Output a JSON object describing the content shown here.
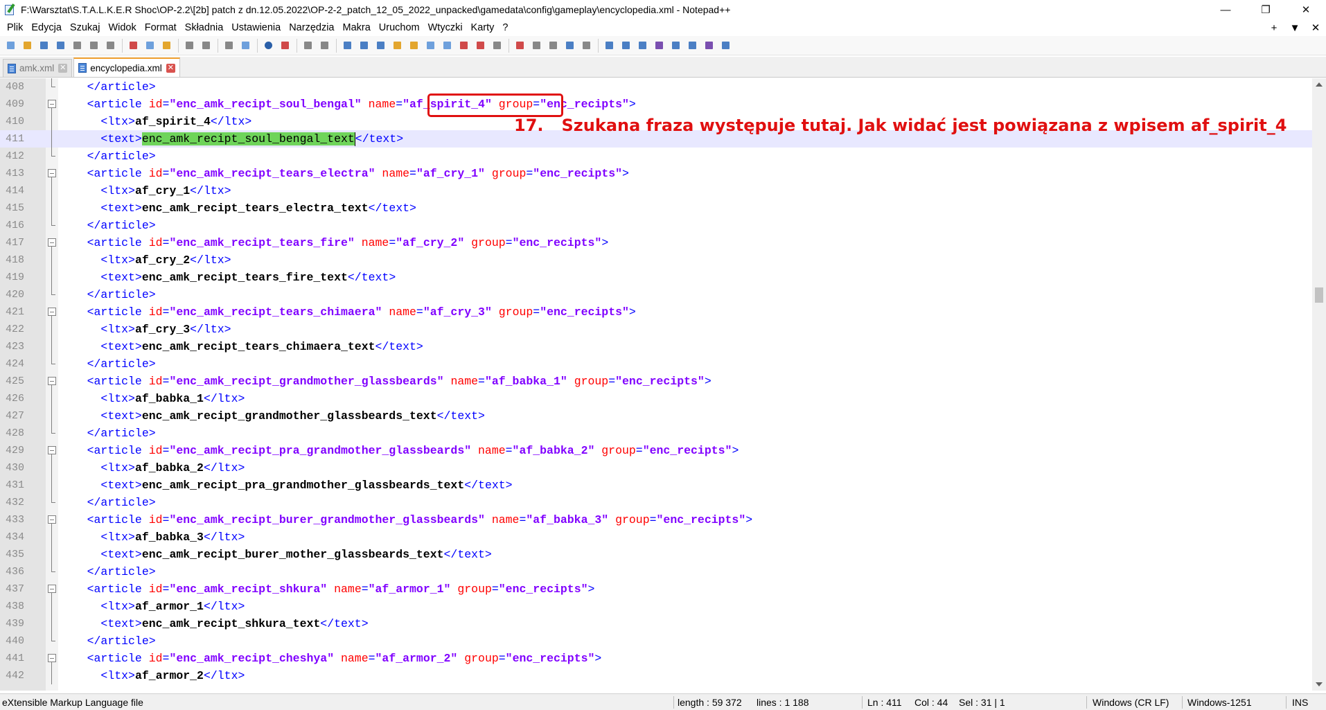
{
  "window": {
    "title": "F:\\Warsztat\\S.T.A.L.K.E.R Shoc\\OP-2.2\\[2b] patch z dn.12.05.2022\\OP-2-2_patch_12_05_2022_unpacked\\gamedata\\config\\gameplay\\encyclopedia.xml - Notepad++",
    "minimize": "—",
    "maximize": "❐",
    "close": "✕"
  },
  "menu": {
    "items": [
      "Plik",
      "Edycja",
      "Szukaj",
      "Widok",
      "Format",
      "Składnia",
      "Ustawienia",
      "Narzędzia",
      "Makra",
      "Uruchom",
      "Wtyczki",
      "Karty",
      "?"
    ],
    "right": [
      "+",
      "▼",
      "✕"
    ]
  },
  "tabs": [
    {
      "label": "amk.xml",
      "active": false
    },
    {
      "label": "encyclopedia.xml",
      "active": true
    }
  ],
  "editor": {
    "lines": [
      {
        "n": "408",
        "fold": "mid",
        "indent": 2,
        "parts": [
          [
            "tag",
            "</article>"
          ]
        ]
      },
      {
        "n": "409",
        "fold": "box",
        "indent": 2,
        "parts": [
          [
            "tag",
            "<article "
          ],
          [
            "attr",
            "id"
          ],
          [
            "tag",
            "="
          ],
          [
            "val",
            "\"enc_amk_recipt_soul_bengal\""
          ],
          [
            "tag",
            " "
          ],
          [
            "attr",
            "name"
          ],
          [
            "tag",
            "="
          ],
          [
            "val",
            "\"af_spirit_4\""
          ],
          [
            "tag",
            " "
          ],
          [
            "attr",
            "group"
          ],
          [
            "tag",
            "="
          ],
          [
            "val",
            "\"enc_recipts\""
          ],
          [
            "tag",
            ">"
          ]
        ]
      },
      {
        "n": "410",
        "fold": "mid",
        "indent": 3,
        "parts": [
          [
            "tag",
            "<ltx>"
          ],
          [
            "txt",
            "af_spirit_4"
          ],
          [
            "tag",
            "</ltx>"
          ]
        ]
      },
      {
        "n": "411",
        "fold": "mid",
        "indent": 3,
        "current": true,
        "parts": [
          [
            "tag",
            "<text>"
          ],
          [
            "sel",
            "enc_amk_recipt_soul_bengal_text"
          ],
          [
            "caret",
            ""
          ],
          [
            "tag",
            "</text>"
          ]
        ]
      },
      {
        "n": "412",
        "fold": "mid",
        "indent": 2,
        "parts": [
          [
            "tag",
            "</article>"
          ]
        ]
      },
      {
        "n": "413",
        "fold": "box",
        "indent": 2,
        "parts": [
          [
            "tag",
            "<article "
          ],
          [
            "attr",
            "id"
          ],
          [
            "tag",
            "="
          ],
          [
            "val",
            "\"enc_amk_recipt_tears_electra\""
          ],
          [
            "tag",
            " "
          ],
          [
            "attr",
            "name"
          ],
          [
            "tag",
            "="
          ],
          [
            "val",
            "\"af_cry_1\""
          ],
          [
            "tag",
            " "
          ],
          [
            "attr",
            "group"
          ],
          [
            "tag",
            "="
          ],
          [
            "val",
            "\"enc_recipts\""
          ],
          [
            "tag",
            ">"
          ]
        ]
      },
      {
        "n": "414",
        "fold": "mid",
        "indent": 3,
        "parts": [
          [
            "tag",
            "<ltx>"
          ],
          [
            "txt",
            "af_cry_1"
          ],
          [
            "tag",
            "</ltx>"
          ]
        ]
      },
      {
        "n": "415",
        "fold": "mid",
        "indent": 3,
        "parts": [
          [
            "tag",
            "<text>"
          ],
          [
            "txt",
            "enc_amk_recipt_tears_electra_text"
          ],
          [
            "tag",
            "</text>"
          ]
        ]
      },
      {
        "n": "416",
        "fold": "mid",
        "indent": 2,
        "parts": [
          [
            "tag",
            "</article>"
          ]
        ]
      },
      {
        "n": "417",
        "fold": "box",
        "indent": 2,
        "parts": [
          [
            "tag",
            "<article "
          ],
          [
            "attr",
            "id"
          ],
          [
            "tag",
            "="
          ],
          [
            "val",
            "\"enc_amk_recipt_tears_fire\""
          ],
          [
            "tag",
            " "
          ],
          [
            "attr",
            "name"
          ],
          [
            "tag",
            "="
          ],
          [
            "val",
            "\"af_cry_2\""
          ],
          [
            "tag",
            " "
          ],
          [
            "attr",
            "group"
          ],
          [
            "tag",
            "="
          ],
          [
            "val",
            "\"enc_recipts\""
          ],
          [
            "tag",
            ">"
          ]
        ]
      },
      {
        "n": "418",
        "fold": "mid",
        "indent": 3,
        "parts": [
          [
            "tag",
            "<ltx>"
          ],
          [
            "txt",
            "af_cry_2"
          ],
          [
            "tag",
            "</ltx>"
          ]
        ]
      },
      {
        "n": "419",
        "fold": "mid",
        "indent": 3,
        "parts": [
          [
            "tag",
            "<text>"
          ],
          [
            "txt",
            "enc_amk_recipt_tears_fire_text"
          ],
          [
            "tag",
            "</text>"
          ]
        ]
      },
      {
        "n": "420",
        "fold": "mid",
        "indent": 2,
        "parts": [
          [
            "tag",
            "</article>"
          ]
        ]
      },
      {
        "n": "421",
        "fold": "box",
        "indent": 2,
        "parts": [
          [
            "tag",
            "<article "
          ],
          [
            "attr",
            "id"
          ],
          [
            "tag",
            "="
          ],
          [
            "val",
            "\"enc_amk_recipt_tears_chimaera\""
          ],
          [
            "tag",
            " "
          ],
          [
            "attr",
            "name"
          ],
          [
            "tag",
            "="
          ],
          [
            "val",
            "\"af_cry_3\""
          ],
          [
            "tag",
            " "
          ],
          [
            "attr",
            "group"
          ],
          [
            "tag",
            "="
          ],
          [
            "val",
            "\"enc_recipts\""
          ],
          [
            "tag",
            ">"
          ]
        ]
      },
      {
        "n": "422",
        "fold": "mid",
        "indent": 3,
        "parts": [
          [
            "tag",
            "<ltx>"
          ],
          [
            "txt",
            "af_cry_3"
          ],
          [
            "tag",
            "</ltx>"
          ]
        ]
      },
      {
        "n": "423",
        "fold": "mid",
        "indent": 3,
        "parts": [
          [
            "tag",
            "<text>"
          ],
          [
            "txt",
            "enc_amk_recipt_tears_chimaera_text"
          ],
          [
            "tag",
            "</text>"
          ]
        ]
      },
      {
        "n": "424",
        "fold": "mid",
        "indent": 2,
        "parts": [
          [
            "tag",
            "</article>"
          ]
        ]
      },
      {
        "n": "425",
        "fold": "box",
        "indent": 2,
        "parts": [
          [
            "tag",
            "<article "
          ],
          [
            "attr",
            "id"
          ],
          [
            "tag",
            "="
          ],
          [
            "val",
            "\"enc_amk_recipt_grandmother_glassbeards\""
          ],
          [
            "tag",
            " "
          ],
          [
            "attr",
            "name"
          ],
          [
            "tag",
            "="
          ],
          [
            "val",
            "\"af_babka_1\""
          ],
          [
            "tag",
            " "
          ],
          [
            "attr",
            "group"
          ],
          [
            "tag",
            "="
          ],
          [
            "val",
            "\"enc_recipts\""
          ],
          [
            "tag",
            ">"
          ]
        ]
      },
      {
        "n": "426",
        "fold": "mid",
        "indent": 3,
        "parts": [
          [
            "tag",
            "<ltx>"
          ],
          [
            "txt",
            "af_babka_1"
          ],
          [
            "tag",
            "</ltx>"
          ]
        ]
      },
      {
        "n": "427",
        "fold": "mid",
        "indent": 3,
        "parts": [
          [
            "tag",
            "<text>"
          ],
          [
            "txt",
            "enc_amk_recipt_grandmother_glassbeards_text"
          ],
          [
            "tag",
            "</text>"
          ]
        ]
      },
      {
        "n": "428",
        "fold": "mid",
        "indent": 2,
        "parts": [
          [
            "tag",
            "</article>"
          ]
        ]
      },
      {
        "n": "429",
        "fold": "box",
        "indent": 2,
        "parts": [
          [
            "tag",
            "<article "
          ],
          [
            "attr",
            "id"
          ],
          [
            "tag",
            "="
          ],
          [
            "val",
            "\"enc_amk_recipt_pra_grandmother_glassbeards\""
          ],
          [
            "tag",
            " "
          ],
          [
            "attr",
            "name"
          ],
          [
            "tag",
            "="
          ],
          [
            "val",
            "\"af_babka_2\""
          ],
          [
            "tag",
            " "
          ],
          [
            "attr",
            "group"
          ],
          [
            "tag",
            "="
          ],
          [
            "val",
            "\"enc_recipts\""
          ],
          [
            "tag",
            ">"
          ]
        ]
      },
      {
        "n": "430",
        "fold": "mid",
        "indent": 3,
        "parts": [
          [
            "tag",
            "<ltx>"
          ],
          [
            "txt",
            "af_babka_2"
          ],
          [
            "tag",
            "</ltx>"
          ]
        ]
      },
      {
        "n": "431",
        "fold": "mid",
        "indent": 3,
        "parts": [
          [
            "tag",
            "<text>"
          ],
          [
            "txt",
            "enc_amk_recipt_pra_grandmother_glassbeards_text"
          ],
          [
            "tag",
            "</text>"
          ]
        ]
      },
      {
        "n": "432",
        "fold": "mid",
        "indent": 2,
        "parts": [
          [
            "tag",
            "</article>"
          ]
        ]
      },
      {
        "n": "433",
        "fold": "box",
        "indent": 2,
        "parts": [
          [
            "tag",
            "<article "
          ],
          [
            "attr",
            "id"
          ],
          [
            "tag",
            "="
          ],
          [
            "val",
            "\"enc_amk_recipt_burer_grandmother_glassbeards\""
          ],
          [
            "tag",
            " "
          ],
          [
            "attr",
            "name"
          ],
          [
            "tag",
            "="
          ],
          [
            "val",
            "\"af_babka_3\""
          ],
          [
            "tag",
            " "
          ],
          [
            "attr",
            "group"
          ],
          [
            "tag",
            "="
          ],
          [
            "val",
            "\"enc_recipts\""
          ],
          [
            "tag",
            ">"
          ]
        ]
      },
      {
        "n": "434",
        "fold": "mid",
        "indent": 3,
        "parts": [
          [
            "tag",
            "<ltx>"
          ],
          [
            "txt",
            "af_babka_3"
          ],
          [
            "tag",
            "</ltx>"
          ]
        ]
      },
      {
        "n": "435",
        "fold": "mid",
        "indent": 3,
        "parts": [
          [
            "tag",
            "<text>"
          ],
          [
            "txt",
            "enc_amk_recipt_burer_mother_glassbeards_text"
          ],
          [
            "tag",
            "</text>"
          ]
        ]
      },
      {
        "n": "436",
        "fold": "mid",
        "indent": 2,
        "parts": [
          [
            "tag",
            "</article>"
          ]
        ]
      },
      {
        "n": "437",
        "fold": "box",
        "indent": 2,
        "parts": [
          [
            "tag",
            "<article "
          ],
          [
            "attr",
            "id"
          ],
          [
            "tag",
            "="
          ],
          [
            "val",
            "\"enc_amk_recipt_shkura\""
          ],
          [
            "tag",
            " "
          ],
          [
            "attr",
            "name"
          ],
          [
            "tag",
            "="
          ],
          [
            "val",
            "\"af_armor_1\""
          ],
          [
            "tag",
            " "
          ],
          [
            "attr",
            "group"
          ],
          [
            "tag",
            "="
          ],
          [
            "val",
            "\"enc_recipts\""
          ],
          [
            "tag",
            ">"
          ]
        ]
      },
      {
        "n": "438",
        "fold": "mid",
        "indent": 3,
        "parts": [
          [
            "tag",
            "<ltx>"
          ],
          [
            "txt",
            "af_armor_1"
          ],
          [
            "tag",
            "</ltx>"
          ]
        ]
      },
      {
        "n": "439",
        "fold": "mid",
        "indent": 3,
        "parts": [
          [
            "tag",
            "<text>"
          ],
          [
            "txt",
            "enc_amk_recipt_shkura_text"
          ],
          [
            "tag",
            "</text>"
          ]
        ]
      },
      {
        "n": "440",
        "fold": "mid",
        "indent": 2,
        "parts": [
          [
            "tag",
            "</article>"
          ]
        ]
      },
      {
        "n": "441",
        "fold": "box",
        "indent": 2,
        "parts": [
          [
            "tag",
            "<article "
          ],
          [
            "attr",
            "id"
          ],
          [
            "tag",
            "="
          ],
          [
            "val",
            "\"enc_amk_recipt_cheshya\""
          ],
          [
            "tag",
            " "
          ],
          [
            "attr",
            "name"
          ],
          [
            "tag",
            "="
          ],
          [
            "val",
            "\"af_armor_2\""
          ],
          [
            "tag",
            " "
          ],
          [
            "attr",
            "group"
          ],
          [
            "tag",
            "="
          ],
          [
            "val",
            "\"enc_recipts\""
          ],
          [
            "tag",
            ">"
          ]
        ]
      },
      {
        "n": "442",
        "fold": "mid",
        "indent": 3,
        "parts": [
          [
            "tag",
            "<ltx>"
          ],
          [
            "txt",
            "af_armor_2"
          ],
          [
            "tag",
            "</ltx>"
          ]
        ]
      }
    ]
  },
  "annotation": {
    "number": "17.",
    "text": "Szukana fraza występuje tutaj. Jak widać jest powiązana z wpisem af_spirit_4",
    "color": "#e01010"
  },
  "status": {
    "file_type": "eXtensible Markup Language file",
    "length": "length : 59 372",
    "lines": "lines : 1 188",
    "ln": "Ln : 411",
    "col": "Col : 44",
    "sel": "Sel : 31 | 1",
    "eol": "Windows (CR LF)",
    "encoding": "Windows-1251",
    "mode": "INS"
  }
}
